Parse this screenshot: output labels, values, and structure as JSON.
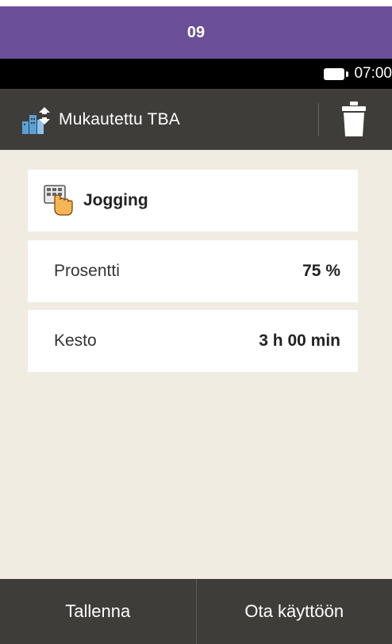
{
  "topbar": {
    "title": "09"
  },
  "status": {
    "time": "07:00"
  },
  "header": {
    "title": "Mukautettu TBA",
    "app_icon": "buildings-arrows-icon",
    "delete_icon": "trash-icon"
  },
  "mode": {
    "label": "Jogging",
    "icon": "hand-keypad-icon"
  },
  "rows": [
    {
      "label": "Prosentti",
      "value": "75 %"
    },
    {
      "label": "Kesto",
      "value": "3 h 00 min"
    }
  ],
  "footer": {
    "save_label": "Tallenna",
    "activate_label": "Ota käyttöön"
  },
  "colors": {
    "topbar": "#6b4f97",
    "header": "#3f3d3a",
    "background": "#f1ece2",
    "card": "#ffffff"
  }
}
